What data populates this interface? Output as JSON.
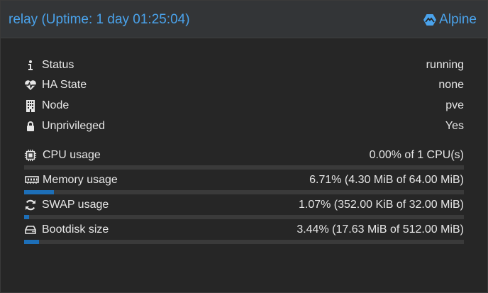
{
  "header": {
    "title": "relay (Uptime: 1 day 01:25:04)",
    "ostype": "Alpine"
  },
  "info": [
    {
      "label": "Status",
      "value": "running",
      "icon": "info-icon"
    },
    {
      "label": "HA State",
      "value": "none",
      "icon": "heartbeat-icon"
    },
    {
      "label": "Node",
      "value": "pve",
      "icon": "building-icon"
    },
    {
      "label": "Unprivileged",
      "value": "Yes",
      "icon": "lock-icon"
    }
  ],
  "usage": [
    {
      "label": "CPU usage",
      "value": "0.00% of 1 CPU(s)",
      "icon": "cpu-icon",
      "fraction": 0.0
    },
    {
      "label": "Memory usage",
      "value": "6.71% (4.30 MiB of 64.00 MiB)",
      "icon": "memory-icon",
      "fraction": 0.0671
    },
    {
      "label": "SWAP usage",
      "value": "1.07% (352.00 KiB of 32.00 MiB)",
      "icon": "refresh-icon",
      "fraction": 0.0107
    },
    {
      "label": "Bootdisk size",
      "value": "3.44% (17.63 MiB of 512.00 MiB)",
      "icon": "hdd-icon",
      "fraction": 0.0344
    }
  ],
  "colors": {
    "accent": "#4aa3ec",
    "bar_fill": "#1d6fb8",
    "bar_track": "#3a3a3a"
  }
}
